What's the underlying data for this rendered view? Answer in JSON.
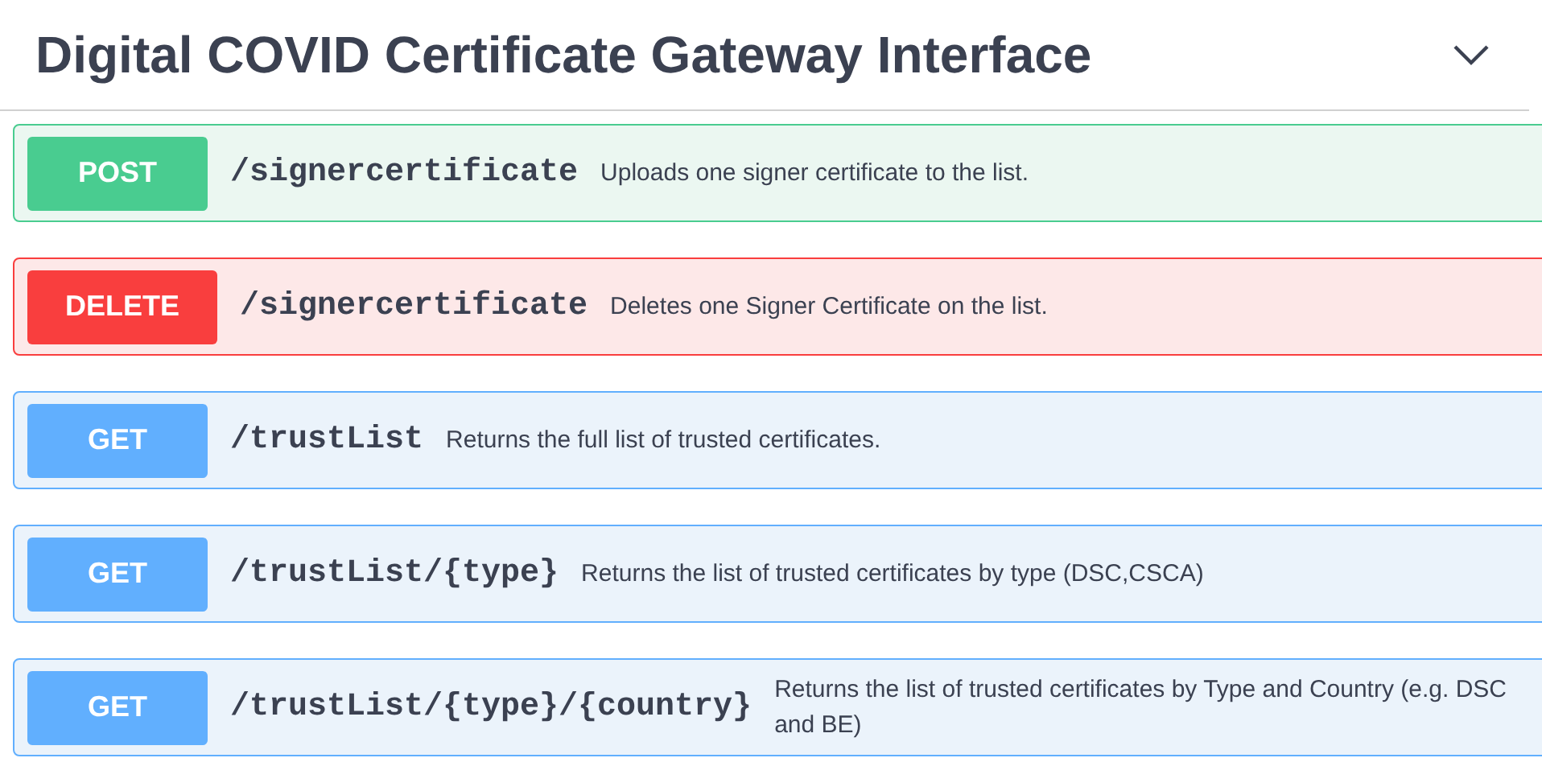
{
  "section": {
    "title": "Digital COVID Certificate Gateway Interface",
    "expanded": true
  },
  "operations": [
    {
      "kind": "post",
      "method": "POST",
      "path": "/signercertificate",
      "summary": "Uploads one signer certificate to the list."
    },
    {
      "kind": "delete",
      "method": "DELETE",
      "path": "/signercertificate",
      "summary": "Deletes one Signer Certificate on the list."
    },
    {
      "kind": "get",
      "method": "GET",
      "path": "/trustList",
      "summary": "Returns the full list of trusted certificates."
    },
    {
      "kind": "get",
      "method": "GET",
      "path": "/trustList/{type}",
      "summary": "Returns the list of trusted certificates by type (DSC,CSCA)"
    },
    {
      "kind": "get",
      "method": "GET",
      "path": "/trustList/{type}/{country}",
      "summary": "Returns the list of trusted certificates by Type and Country (e.g. DSC and BE)"
    }
  ]
}
